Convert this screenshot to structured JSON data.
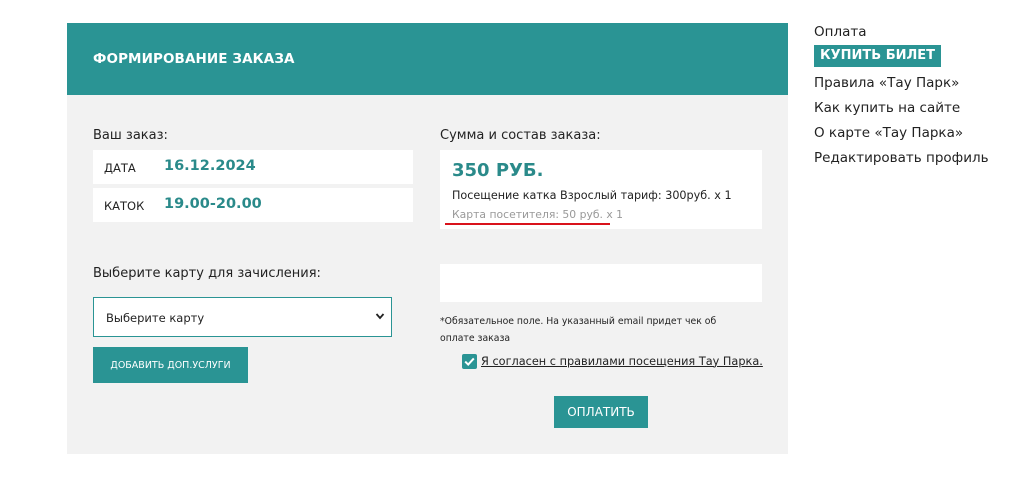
{
  "form": {
    "title": "ФОРМИРОВАНИЕ ЗАКАЗА",
    "order_label": "Ваш заказ:",
    "rows": [
      {
        "key": "ДАТА",
        "value": "16.12.2024"
      },
      {
        "key": "КАТОК",
        "value": "19.00-20.00"
      }
    ],
    "card_label": "Выберите карту для зачисления:",
    "card_select": {
      "selected": "Выберите карту"
    },
    "add_button": "ДОБАВИТЬ ДОП.УСЛУГИ"
  },
  "summary": {
    "label": "Сумма и состав заказа:",
    "total": "350 РУБ.",
    "line1": "Посещение катка Взрослый тариф: 300руб. х 1",
    "line2": "Карта посетителя: 50 руб. х 1"
  },
  "email": {
    "note": "*Обязательное поле. На указанный email придет чек об оплате заказа"
  },
  "agree": {
    "label": "Я согласен с правилами посещения Тау Парка.",
    "checked": true
  },
  "pay_button": "ОПЛАТИТЬ",
  "sidebar": {
    "items": [
      {
        "label": "Оплата"
      },
      {
        "label": "КУПИТЬ БИЛЕТ",
        "active": true
      },
      {
        "label": "Правила «Тау Парк»"
      },
      {
        "label": "Как купить на сайте"
      },
      {
        "label": "О карте «Тау Парка»"
      },
      {
        "label": "Редактировать профиль"
      }
    ]
  },
  "colors": {
    "accent": "#2a9494",
    "accent_text": "#2a8a8a",
    "underline": "#d9121b"
  },
  "icons": {
    "select_chevron": "chevron-down-icon",
    "checkbox": "checkmark-icon"
  }
}
